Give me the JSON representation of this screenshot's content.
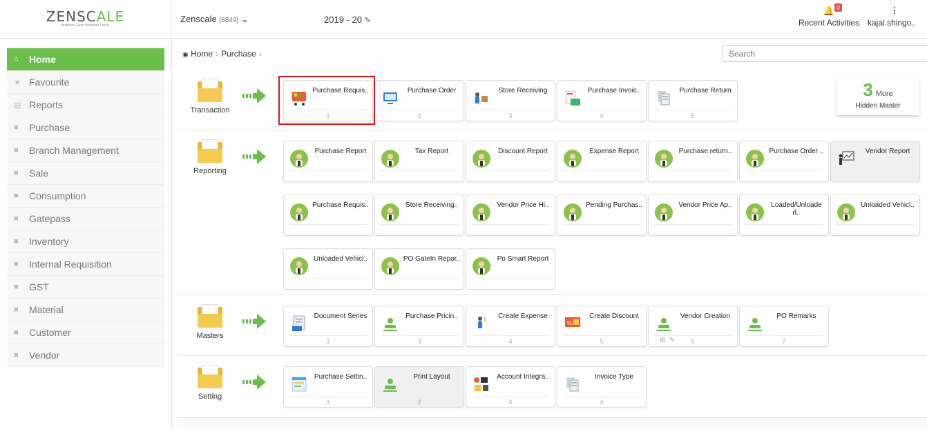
{
  "brand": {
    "logo_text": "ZENSC",
    "logo_accent": "ALE",
    "tagline": "Business Ease Business Focus"
  },
  "header": {
    "company": "Zenscale",
    "company_code": "[8849]",
    "year": "2019 - 20",
    "recent_label": "Recent Activities",
    "recent_badge": "0",
    "user": "kajal.shingo.."
  },
  "sidebar": {
    "items": [
      {
        "label": "Home",
        "icon": "home-icon",
        "active": true
      },
      {
        "label": "Favourite",
        "icon": "star-icon"
      },
      {
        "label": "Reports",
        "icon": "file-icon"
      },
      {
        "label": "Purchase",
        "icon": "folder-icon"
      },
      {
        "label": "Branch Management",
        "icon": "folder-icon"
      },
      {
        "label": "Sale",
        "icon": "folder-icon"
      },
      {
        "label": "Consumption",
        "icon": "folder-icon"
      },
      {
        "label": "Gatepass",
        "icon": "folder-icon"
      },
      {
        "label": "Inventory",
        "icon": "folder-icon"
      },
      {
        "label": "Internal Requisition",
        "icon": "folder-icon"
      },
      {
        "label": "GST",
        "icon": "folder-icon"
      },
      {
        "label": "Material",
        "icon": "folder-icon"
      },
      {
        "label": "Customer",
        "icon": "folder-icon"
      },
      {
        "label": "Vendor",
        "icon": "folder-icon"
      }
    ]
  },
  "breadcrumb": {
    "home": "Home",
    "current": "Purchase"
  },
  "search": {
    "placeholder": "Search"
  },
  "more": {
    "count": "3",
    "more_label": "More",
    "caption": "Hidden Master"
  },
  "sections": {
    "transaction": {
      "title": "Transaction",
      "cards": [
        {
          "label": "Purchase Requis..",
          "num": "1"
        },
        {
          "label": "Purchase Order",
          "num": "2"
        },
        {
          "label": "Store Receiving",
          "num": "3"
        },
        {
          "label": "Purchase Invoic..",
          "num": "4"
        },
        {
          "label": "Purchase Return",
          "num": "5"
        }
      ]
    },
    "reporting": {
      "title": "Reporting",
      "cards": [
        {
          "label": "Purchase Report"
        },
        {
          "label": "Tax Report"
        },
        {
          "label": "Discount Report"
        },
        {
          "label": "Expense Report"
        },
        {
          "label": "Purchase return.."
        },
        {
          "label": "Purchase Order .."
        },
        {
          "label": "Vendor Report"
        },
        {
          "label": "Purchase Requis.."
        },
        {
          "label": "Store Receiving.."
        },
        {
          "label": "Vendor Price Hi.."
        },
        {
          "label": "Pending Purchas.."
        },
        {
          "label": "Vendor Price Ap.."
        },
        {
          "label": "Loaded/Unloade d.."
        },
        {
          "label": "Unloaded Vehicl.."
        },
        {
          "label": "Unloaded Vehicl.."
        },
        {
          "label": "PO GateIn Repor.."
        },
        {
          "label": "Po Smart Report"
        }
      ]
    },
    "masters": {
      "title": "Masters",
      "cards": [
        {
          "label": "Document Series",
          "num": "1"
        },
        {
          "label": "Purchase Pricin..",
          "num": "3"
        },
        {
          "label": "Create Expense",
          "num": "4"
        },
        {
          "label": "Create Discount",
          "num": "5"
        },
        {
          "label": "Vendor Creation",
          "num": "6"
        },
        {
          "label": "PO Remarks",
          "num": "7"
        }
      ]
    },
    "setting": {
      "title": "Setting",
      "cards": [
        {
          "label": "Purchase Settin..",
          "num": "1"
        },
        {
          "label": "Print Layout",
          "num": "2"
        },
        {
          "label": "Account Integra..",
          "num": "4"
        },
        {
          "label": "Invoice Type",
          "num": "4"
        }
      ]
    }
  },
  "colors": {
    "accent": "#6abf4b",
    "highlight": "#e0141b",
    "folder": "#f5cb4f"
  }
}
